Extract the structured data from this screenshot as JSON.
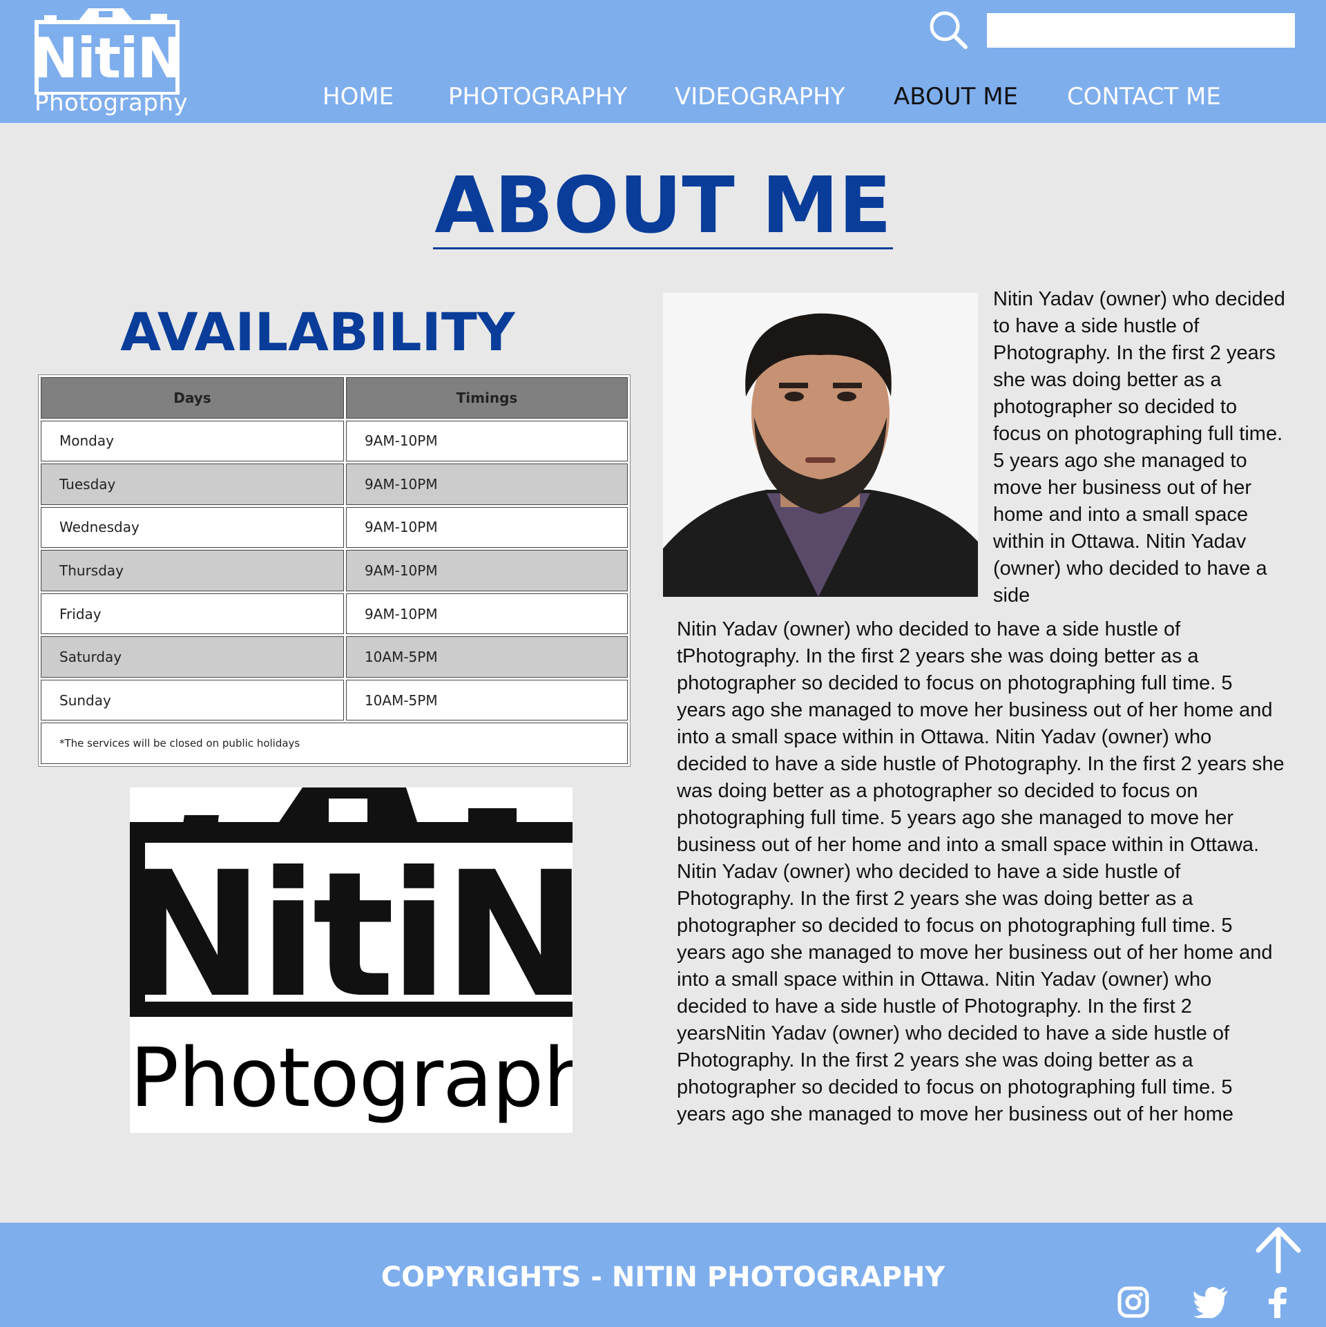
{
  "header": {
    "logo_text": "NitiN",
    "logo_sub": "Photography",
    "search_placeholder": "",
    "nav": [
      {
        "label": "HOME",
        "active": false
      },
      {
        "label": "PHOTOGRAPHY",
        "active": false
      },
      {
        "label": "VIDEOGRAPHY",
        "active": false
      },
      {
        "label": "ABOUT ME",
        "active": true
      },
      {
        "label": "CONTACT ME",
        "active": false
      }
    ]
  },
  "page_title": "ABOUT ME",
  "availability": {
    "title": "AVAILABILITY",
    "headers": [
      "Days",
      "Timings"
    ],
    "rows": [
      [
        "Monday",
        "9AM-10PM"
      ],
      [
        "Tuesday",
        "9AM-10PM"
      ],
      [
        "Wednesday",
        "9AM-10PM"
      ],
      [
        "Thursday",
        "9AM-10PM"
      ],
      [
        "Friday",
        "9AM-10PM"
      ],
      [
        "Saturday",
        "10AM-5PM"
      ],
      [
        "Sunday",
        "10AM-5PM"
      ]
    ],
    "note": "*The services will be closed on public holidays"
  },
  "big_logo": {
    "text": "NitiN",
    "sub": "Photography"
  },
  "bio": {
    "side": "Nitin Yadav (owner) who decided to have a side hustle of Photography. In the first 2 years she was doing better as a photographer so decided to focus on photographing full time. 5 years ago she managed to move her business out of her home and into a small space within in Ottawa. Nitin Yadav (owner) who decided to have a side",
    "main": "Nitin Yadav (owner) who decided to have a side hustle of tPhotography. In the first 2 years she was doing better as a photographer so decided to focus on photographing full time. 5 years ago she managed to move her business out of her home and into a small space within in Ottawa. Nitin Yadav (owner) who decided to have a side hustle of Photography. In the first 2 years she was doing better as a photographer so decided to focus on photographing full time. 5 years ago she managed to move her business out of her home and into a small space within in Ottawa. Nitin Yadav (owner) who decided to have a side hustle of Photography. In the first 2 years she was doing better as a photographer so decided to focus on photographing full time. 5 years ago she managed to move her business out of her home and into a small space within in Ottawa. Nitin Yadav (owner) who decided to have a side hustle of Photography. In the first 2 yearsNitin Yadav (owner) who decided to have a side hustle of Photography. In the first 2 years she was doing better as a photographer so decided to focus on photographing full time. 5 years ago she managed to move her business out of her home"
  },
  "footer": {
    "copyright": "COPYRIGHTS - NITIN PHOTOGRAPHY",
    "icons": [
      "arrow-up-icon",
      "instagram-icon",
      "twitter-icon",
      "facebook-icon"
    ]
  },
  "colors": {
    "header_bg": "#7faeed",
    "title_blue": "#0a3d9a",
    "page_bg": "#e8e8e8",
    "table_header": "#808080",
    "table_alt_row": "#cccccc"
  }
}
